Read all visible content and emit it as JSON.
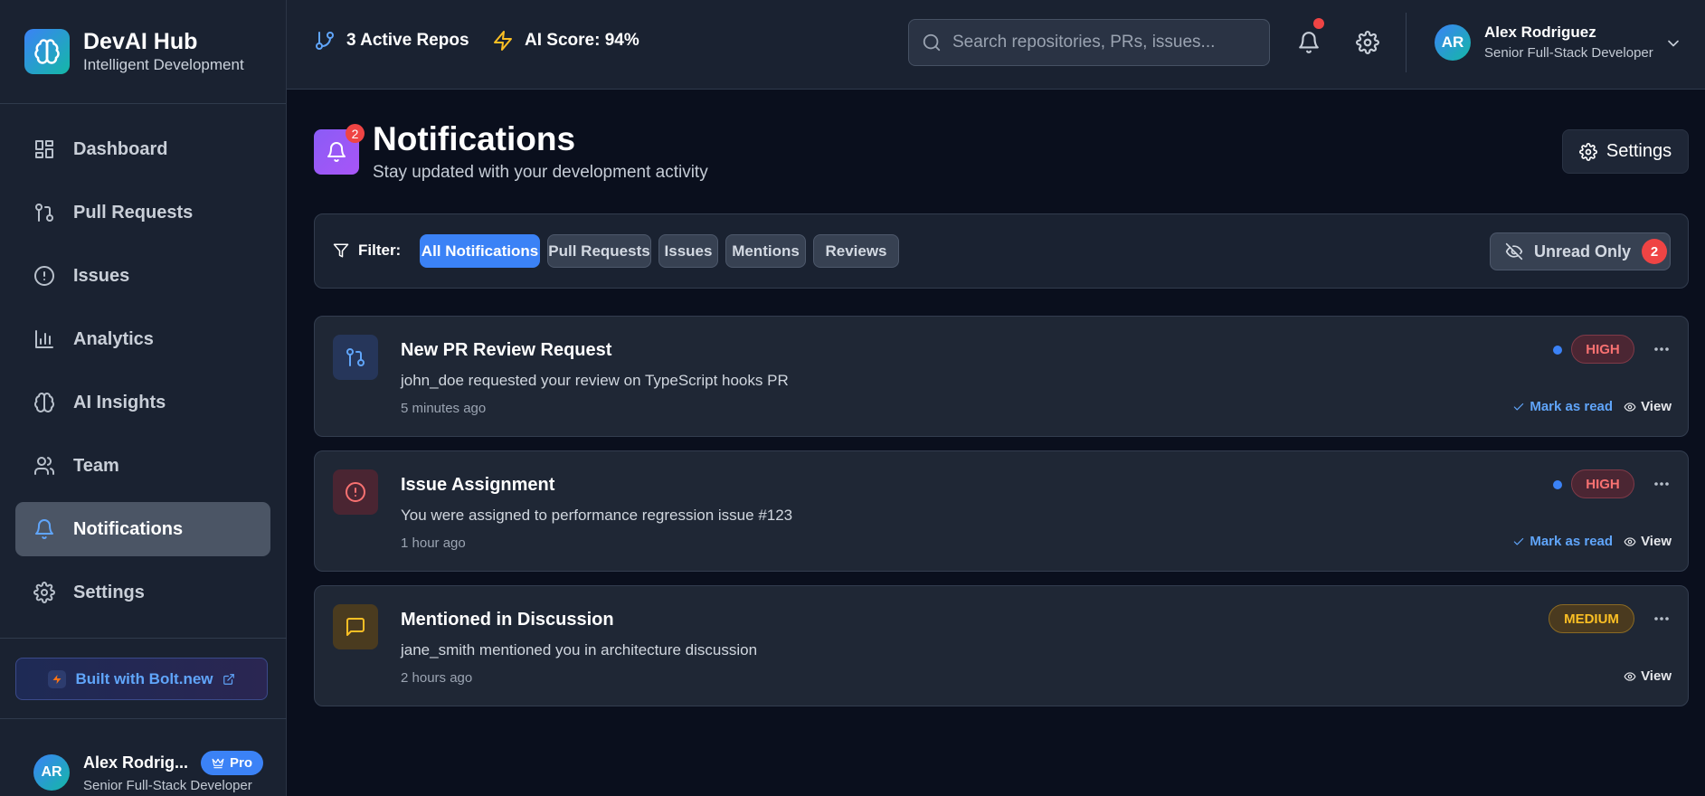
{
  "brand": {
    "name": "DevAI Hub",
    "subtitle": "Intelligent Development"
  },
  "sidebar": {
    "items": [
      {
        "label": "Dashboard",
        "icon": "dashboard-icon"
      },
      {
        "label": "Pull Requests",
        "icon": "git-pull-request-icon"
      },
      {
        "label": "Issues",
        "icon": "alert-circle-icon"
      },
      {
        "label": "Analytics",
        "icon": "bar-chart-icon"
      },
      {
        "label": "AI Insights",
        "icon": "brain-icon"
      },
      {
        "label": "Team",
        "icon": "users-icon"
      },
      {
        "label": "Notifications",
        "icon": "bell-icon",
        "active": true
      },
      {
        "label": "Settings",
        "icon": "gear-icon"
      }
    ],
    "bolt_label": "Built with Bolt.new",
    "user": {
      "initials": "AR",
      "name": "Alex Rodrig...",
      "role": "Senior Full-Stack Developer",
      "badge": "Pro"
    }
  },
  "header": {
    "repos": "3 Active Repos",
    "ai_score": "AI Score: 94%",
    "search_placeholder": "Search repositories, PRs, issues...",
    "user": {
      "initials": "AR",
      "name": "Alex Rodriguez",
      "role": "Senior Full-Stack Developer"
    }
  },
  "page": {
    "title": "Notifications",
    "subtitle": "Stay updated with your development activity",
    "badge_count": "2",
    "settings_label": "Settings"
  },
  "filter": {
    "label": "Filter:",
    "chips": [
      "All Notifications",
      "Pull Requests",
      "Issues",
      "Mentions",
      "Reviews"
    ],
    "active_index": 0,
    "unread_label": "Unread Only",
    "unread_count": "2"
  },
  "notifications": [
    {
      "title": "New PR Review Request",
      "desc": "john_doe requested your review on TypeScript hooks PR",
      "time": "5 minutes ago",
      "priority": "HIGH",
      "unread": true,
      "icon": "git-pull-request-icon"
    },
    {
      "title": "Issue Assignment",
      "desc": "You were assigned to performance regression issue #123",
      "time": "1 hour ago",
      "priority": "HIGH",
      "unread": true,
      "icon": "alert-circle-icon"
    },
    {
      "title": "Mentioned in Discussion",
      "desc": "jane_smith mentioned you in architecture discussion",
      "time": "2 hours ago",
      "priority": "MEDIUM",
      "unread": false,
      "icon": "message-square-icon"
    }
  ],
  "actions": {
    "mark_read": "Mark as read",
    "view": "View"
  },
  "colors": {
    "accent": "#3b82f6",
    "danger": "#ef4444",
    "warning": "#fbbf24",
    "purple": "#8b5cf6"
  }
}
